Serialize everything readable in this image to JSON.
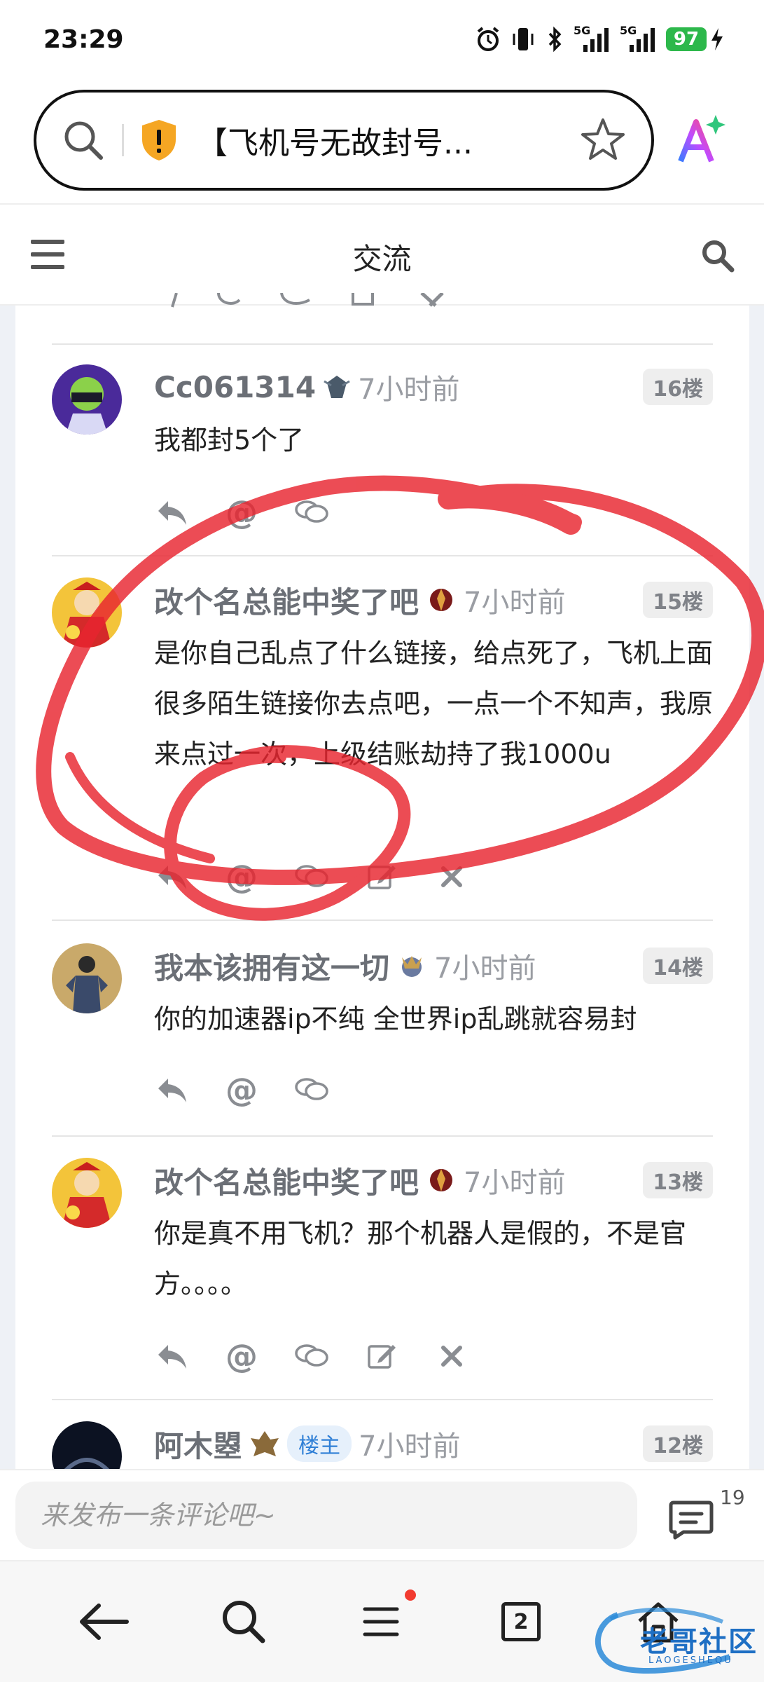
{
  "status_bar": {
    "time": "23:29",
    "battery_level": "97",
    "network_1": "5G",
    "network_2": "5G"
  },
  "browser": {
    "address_text": "【飞机号无故封号...",
    "icons": [
      "search-icon",
      "shield-icon",
      "star-icon",
      "ai-assistant-icon"
    ]
  },
  "site_header": {
    "title": "交流",
    "icons": [
      "menu-icon",
      "search-icon"
    ]
  },
  "comments": [
    {
      "user": "Cc061314",
      "time": "7小时前",
      "floor": "16楼",
      "body": "我都封5个了",
      "actions": [
        "reply-icon",
        "mention-icon",
        "comment-icon"
      ]
    },
    {
      "user": "改个名总能中奖了吧",
      "time": "7小时前",
      "floor": "15楼",
      "body": "是你自己乱点了什么链接，给点死了，飞机上面很多陌生链接你去点吧，一点一个不知声，我原来点过一次，上级结账劫持了我1000u",
      "actions": [
        "reply-icon",
        "mention-icon",
        "comment-icon",
        "edit-icon",
        "delete-icon"
      ]
    },
    {
      "user": "我本该拥有这一切",
      "time": "7小时前",
      "floor": "14楼",
      "body": "你的加速器ip不纯  全世界ip乱跳就容易封",
      "actions": [
        "reply-icon",
        "mention-icon",
        "comment-icon"
      ]
    },
    {
      "user": "改个名总能中奖了吧",
      "time": "7小时前",
      "floor": "13楼",
      "body": "你是真不用飞机？那个机器人是假的，不是官方。。。。",
      "actions": [
        "reply-icon",
        "mention-icon",
        "comment-icon",
        "edit-icon",
        "delete-icon"
      ]
    },
    {
      "user": "阿木曌",
      "badge": "楼主",
      "time": "7小时前",
      "floor": "12楼"
    }
  ],
  "mention_symbol": "@",
  "comment_bar": {
    "placeholder": "来发布一条评论吧~",
    "count": "19"
  },
  "bottom_nav": {
    "tab_count": "2",
    "items": [
      "back-icon",
      "search-icon",
      "menu-icon",
      "tabs-icon",
      "home-icon"
    ]
  },
  "watermark": {
    "text": "老哥社区",
    "subtext": "LAOGESHEQU"
  },
  "colors": {
    "annotation": "#e8252f",
    "badge_blue": "#2f7fd6",
    "battery_green": "#2db84b"
  }
}
